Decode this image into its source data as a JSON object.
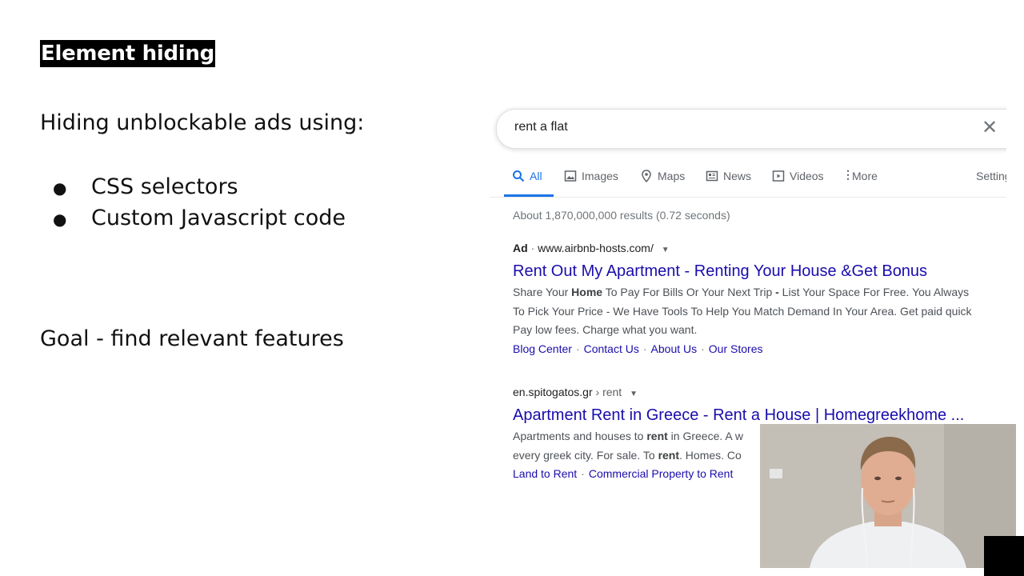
{
  "slide": {
    "title": "Element hiding",
    "intro": "Hiding unblockable ads using:",
    "bullets": [
      "CSS selectors",
      "Custom Javascript code"
    ],
    "goal": "Goal - find relevant features"
  },
  "search": {
    "query": "rent a flat",
    "tabs": [
      {
        "label": "All",
        "icon": "search-icon"
      },
      {
        "label": "Images",
        "icon": "image-icon"
      },
      {
        "label": "Maps",
        "icon": "map-pin-icon"
      },
      {
        "label": "News",
        "icon": "news-icon"
      },
      {
        "label": "Videos",
        "icon": "video-icon"
      },
      {
        "label": "More",
        "icon": "more-vertical-icon"
      },
      {
        "label": "Settings"
      }
    ],
    "stats": "About 1,870,000,000 results (0.72 seconds)",
    "results": [
      {
        "ad_label": "Ad",
        "url": "www.airbnb-hosts.com/",
        "title": "Rent Out My Apartment - Renting Your House &Get Bonus",
        "desc": [
          [
            "Share Your ",
            "Home",
            " To Pay For Bills Or Your Next Trip ",
            "-",
            " List Your Space For Free. You Always"
          ],
          "To Pick Your Price - We Have Tools To Help You Match Demand In Your Area. Get paid quick",
          "Pay low fees. Charge what you want."
        ],
        "links": [
          "Blog Center",
          "Contact Us",
          "About Us",
          "Our Stores"
        ]
      },
      {
        "site": "en.spitogatos.gr",
        "path": "› rent",
        "title": "Apartment Rent in Greece - Rent a House | Homegreekhome ...",
        "desc": [
          [
            "Apartments and houses to ",
            "rent",
            " in Greece. A w"
          ],
          [
            "every greek city. For sale. To ",
            "rent",
            ". Homes. Co"
          ]
        ],
        "links": [
          "Land to Rent",
          "Commercial Property to Rent"
        ]
      }
    ]
  },
  "colors": {
    "link": "#1a0dab",
    "active_tab": "#1a73e8",
    "title_bg": "#000000"
  }
}
